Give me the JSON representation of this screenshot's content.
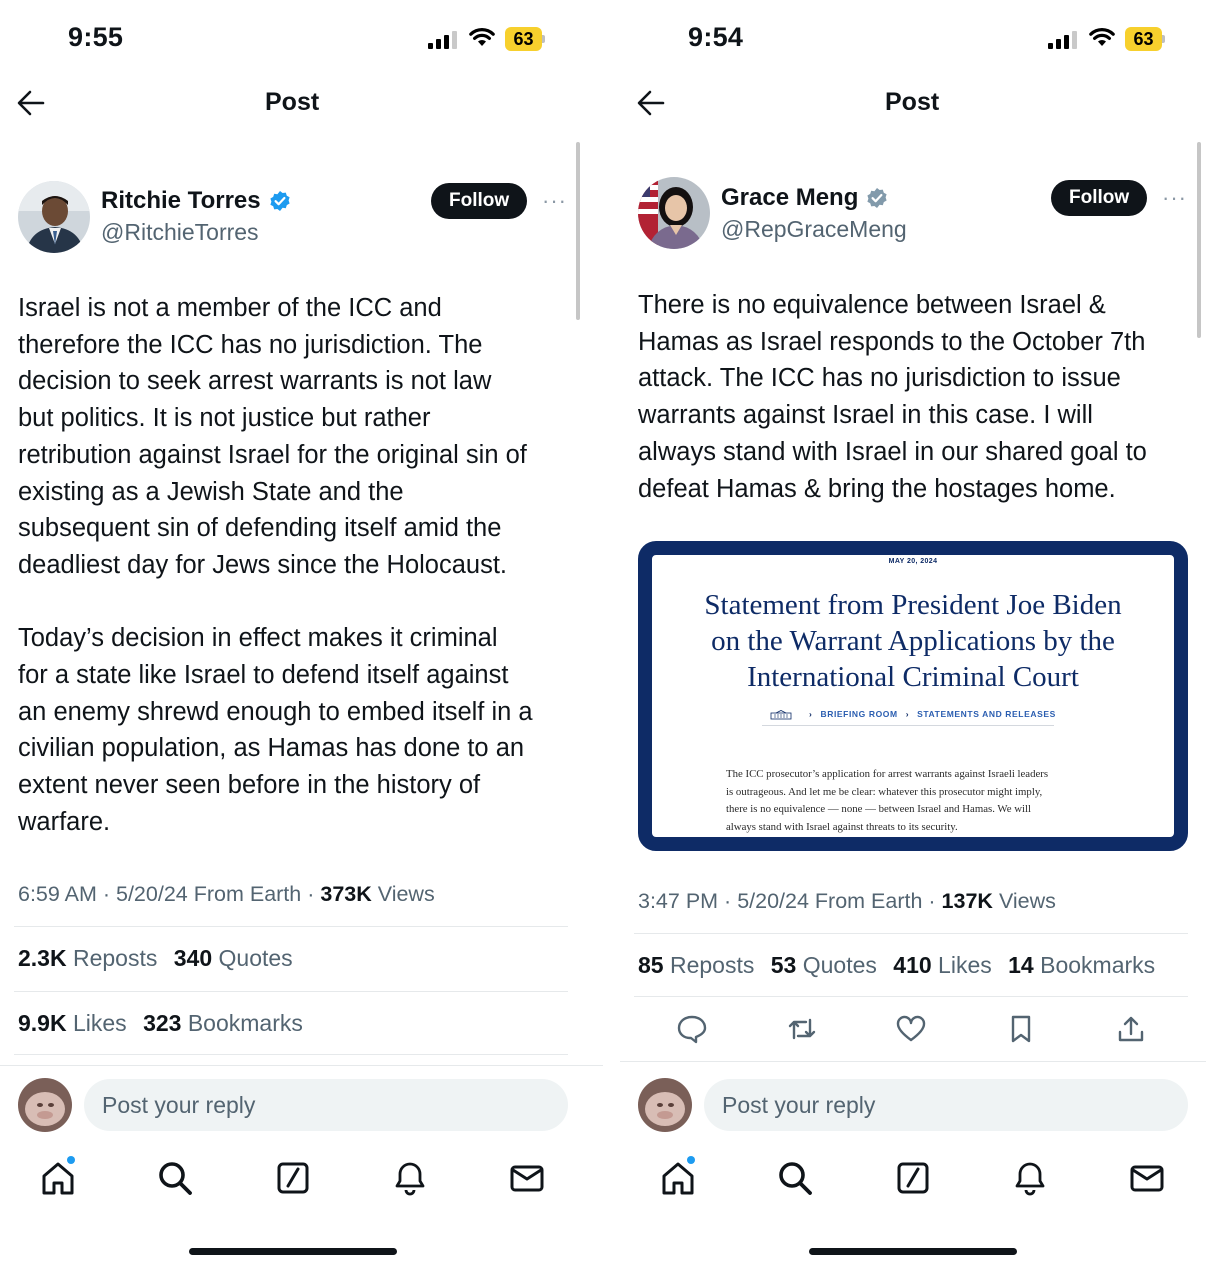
{
  "left": {
    "status": {
      "time": "9:55",
      "battery": "63"
    },
    "header": {
      "title": "Post"
    },
    "author": {
      "name": "Ritchie Torres",
      "handle": "@RitchieTorres"
    },
    "follow_label": "Follow",
    "more_label": "···",
    "post_text": "Israel is not a member of the ICC and\ntherefore the ICC has no jurisdiction. The\ndecision to seek arrest warrants is not law\nbut politics.  It is not justice but rather\nretribution against Israel for the original sin of\nexisting as a Jewish State and the\nsubsequent sin of defending itself amid the\ndeadliest day for Jews since the Holocaust.\n\nToday’s decision in effect makes it criminal\nfor a state like Israel to defend itself against\nan enemy shrewd enough to embed itself in a\ncivilian population, as Hamas has done to an\nextent never seen before in the history of\nwarfare.",
    "meta": {
      "time": "6:59 AM",
      "date": "5/20/24",
      "source": "From Earth",
      "views_count": "373K",
      "views_label": "Views"
    },
    "stats": {
      "reposts_count": "2.3K",
      "reposts_label": "Reposts",
      "quotes_count": "340",
      "quotes_label": "Quotes",
      "likes_count": "9.9K",
      "likes_label": "Likes",
      "bookmarks_count": "323",
      "bookmarks_label": "Bookmarks"
    },
    "reply_placeholder": "Post your reply"
  },
  "right": {
    "status": {
      "time": "9:54",
      "battery": "63"
    },
    "header": {
      "title": "Post"
    },
    "author": {
      "name": "Grace Meng",
      "handle": "@RepGraceMeng"
    },
    "follow_label": "Follow",
    "more_label": "···",
    "post_text": "There is no equivalence between Israel &\nHamas as Israel responds to the October 7th\nattack. The ICC has no jurisdiction to issue\nwarrants against Israel in this case. I will\nalways stand with Israel in our shared goal to\ndefeat Hamas & bring the hostages home.",
    "embed": {
      "date": "MAY 20, 2024",
      "title": "Statement from President Joe Biden\non the Warrant Applications by the\nInternational Criminal Court",
      "crumb1": "BRIEFING ROOM",
      "crumb2": "STATEMENTS AND RELEASES",
      "body": "The ICC prosecutor’s application for arrest warrants against Israeli leaders\nis outrageous. And let me be clear: whatever this prosecutor might imply,\nthere is no equivalence — none — between Israel and Hamas.  We will\nalways stand with Israel against threats to its security."
    },
    "meta": {
      "time": "3:47 PM",
      "date": "5/20/24",
      "source": "From Earth",
      "views_count": "137K",
      "views_label": "Views"
    },
    "stats": {
      "reposts_count": "85",
      "reposts_label": "Reposts",
      "quotes_count": "53",
      "quotes_label": "Quotes",
      "likes_count": "410",
      "likes_label": "Likes",
      "bookmarks_count": "14",
      "bookmarks_label": "Bookmarks"
    },
    "actions": [
      "reply-icon",
      "repost-icon",
      "like-icon",
      "bookmark-icon",
      "share-icon"
    ],
    "reply_placeholder": "Post your reply"
  },
  "tabbar": [
    "home-icon",
    "search-icon",
    "compose-icon",
    "notifications-icon",
    "messages-icon"
  ],
  "colors": {
    "accent": "#1d9bf0",
    "text": "#0f1419",
    "muted": "#536471",
    "embed_navy": "#0e2b66",
    "battery": "#f7d02d"
  }
}
